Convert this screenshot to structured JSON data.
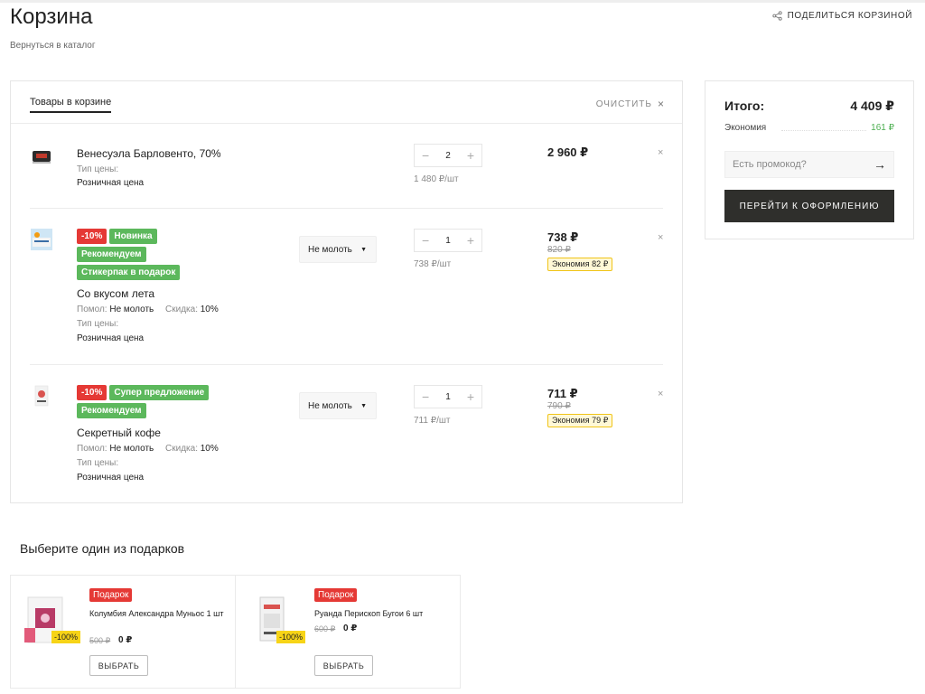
{
  "page": {
    "title": "Корзина",
    "back_link": "Вернуться в каталог",
    "share_label": "ПОДЕЛИТЬСЯ КОРЗИНОЙ"
  },
  "cart": {
    "tab_label": "Товары в корзине",
    "clear_label": "ОЧИСТИТЬ",
    "items": [
      {
        "name": "Венесуэла Барловенто, 70%",
        "price_type_label": "Тип цены:",
        "price_type_value": "Розничная цена",
        "qty": "2",
        "unit_price": "1 480 ₽/шт",
        "price": "2 960 ₽"
      },
      {
        "name": "Со вкусом лета",
        "badges": [
          "-10%",
          "Новинка",
          "Рекомендуем",
          "Стикерпак в подарок"
        ],
        "grind_label": "Помол:",
        "grind_value": "Не молоть",
        "discount_label": "Скидка:",
        "discount_value": "10%",
        "price_type_label": "Тип цены:",
        "price_type_value": "Розничная цена",
        "grind_select": "Не молоть",
        "qty": "1",
        "unit_price": "738 ₽/шт",
        "price": "738 ₽",
        "old_price": "820 ₽",
        "economy": "Экономия  82 ₽"
      },
      {
        "name": "Секретный кофе",
        "badges": [
          "-10%",
          "Супер предложение",
          "Рекомендуем"
        ],
        "grind_label": "Помол:",
        "grind_value": "Не молоть",
        "discount_label": "Скидка:",
        "discount_value": "10%",
        "price_type_label": "Тип цены:",
        "price_type_value": "Розничная цена",
        "grind_select": "Не молоть",
        "qty": "1",
        "unit_price": "711 ₽/шт",
        "price": "711 ₽",
        "old_price": "790 ₽",
        "economy": "Экономия  79 ₽"
      }
    ]
  },
  "summary": {
    "total_label": "Итого:",
    "total_value": "4 409 ₽",
    "economy_label": "Экономия",
    "economy_value": "161 ₽",
    "promo_placeholder": "Есть промокод?",
    "checkout_label": "ПЕРЕЙТИ К ОФОРМЛЕНИЮ"
  },
  "gifts": {
    "title": "Выберите один из подарков",
    "items": [
      {
        "badge": "Подарок",
        "name": "Колумбия Александра Муньос 1 шт",
        "old_price": "500 ₽",
        "new_price": "0 ₽",
        "discount": "-100%",
        "button": "ВЫБРАТЬ"
      },
      {
        "badge": "Подарок",
        "name": "Руанда Перископ Бугои 6 шт",
        "old_price": "600 ₽",
        "new_price": "0 ₽",
        "discount": "-100%",
        "button": "ВЫБРАТЬ"
      }
    ]
  },
  "colors": {
    "accent_dark": "#2f2f2c",
    "badge_red": "#e53935",
    "badge_green": "#5cb85c",
    "economy_green": "#4caf50",
    "economy_tag_border": "#f0c419"
  }
}
